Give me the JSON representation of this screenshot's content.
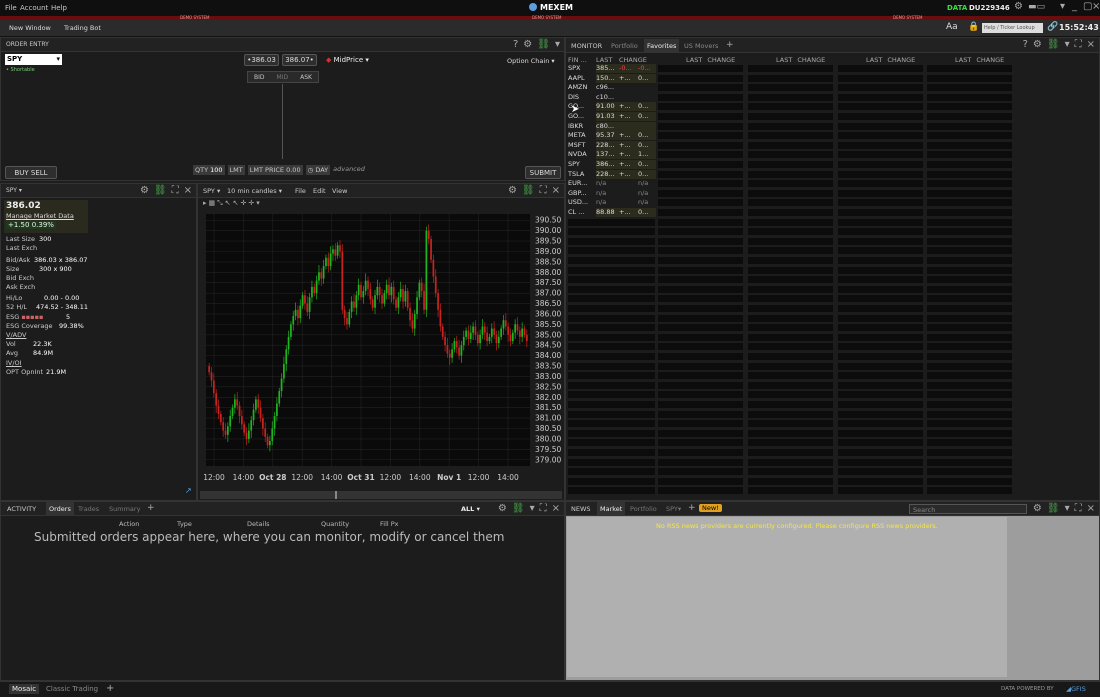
{
  "menu": {
    "file": "File",
    "account": "Account",
    "help": "Help"
  },
  "brand": "MEXEM",
  "demo_label": "DEMO SYSTEM",
  "data_label": "DATA",
  "account_id": "DU229346",
  "clock": "15:52:43",
  "toolbar": {
    "new_window": "New Window",
    "trading_bot": "Trading Bot",
    "font_size": "Aa",
    "ticker_lookup": "Help / Ticker Lookup"
  },
  "order_entry": {
    "title": "ORDER ENTRY",
    "symbol": "SPY",
    "shortable": "• Shortable",
    "bid_price": "•386.03",
    "ask_price": "386.07•",
    "bid": "BID",
    "mid": "MID",
    "ask": "ASK",
    "midprice": "MidPrice",
    "option_chain": "Option Chain",
    "buy_sell": "BUY SELL",
    "qty": "QTY",
    "qty_val": "100",
    "type": "LMT",
    "lmt_price": "LMT PRICE",
    "lmt_val": "0.00",
    "tif": "DAY",
    "advanced": "advanced",
    "submit": "SUBMIT"
  },
  "quote": {
    "symbol": "SPY",
    "last": "386.02",
    "manage": "Manage Market Data",
    "change": "+1.50",
    "pct": "0.39%",
    "rows": [
      [
        "Last Size",
        "300"
      ],
      [
        "Last Exch",
        ""
      ],
      [
        "Bid/Ask",
        "386.03 x 386.07"
      ],
      [
        "Size",
        "300 x 900"
      ],
      [
        "Bid Exch",
        ""
      ],
      [
        "Ask Exch",
        ""
      ],
      [
        "Hi/Lo",
        "0.00 - 0.00"
      ],
      [
        "52 H/L",
        "474.52 - 348.11"
      ],
      [
        "ESG",
        "5"
      ],
      [
        "ESG Coverage",
        "99.38%"
      ],
      [
        "V/ADV",
        ""
      ],
      [
        "Vol",
        "22.3K"
      ],
      [
        "Avg",
        "84.9M"
      ],
      [
        "IV/OI",
        ""
      ],
      [
        "OPT OpnInt",
        "21.9M"
      ]
    ]
  },
  "chart": {
    "symbol": "SPY",
    "interval": "10 min candles",
    "file": "File",
    "edit": "Edit",
    "view": "View"
  },
  "chart_data": {
    "type": "candlestick",
    "x_ticks": [
      "12:00",
      "14:00",
      "Oct 28",
      "12:00",
      "14:00",
      "Oct 31",
      "12:00",
      "14:00",
      "Nov 1",
      "12:00",
      "14:00"
    ],
    "y_ticks": [
      "390.50",
      "390.00",
      "389.50",
      "389.00",
      "388.50",
      "388.00",
      "387.50",
      "387.00",
      "386.50",
      "386.00",
      "385.50",
      "385.00",
      "384.50",
      "384.00",
      "383.50",
      "383.00",
      "382.50",
      "382.00",
      "381.50",
      "381.00",
      "380.50",
      "380.00",
      "379.50",
      "379.00"
    ],
    "ylim": [
      378.7,
      390.8
    ],
    "closes": [
      383.2,
      382.8,
      382.2,
      381.6,
      381.2,
      380.8,
      380.4,
      380.2,
      380.6,
      381.1,
      381.5,
      381.9,
      381.6,
      381.1,
      380.7,
      380.3,
      380.0,
      380.4,
      380.9,
      381.4,
      381.9,
      381.5,
      381.0,
      380.5,
      380.1,
      379.7,
      379.9,
      380.5,
      381.1,
      381.7,
      382.3,
      382.9,
      383.6,
      384.3,
      384.9,
      385.5,
      385.9,
      386.2,
      385.8,
      386.4,
      386.9,
      386.5,
      386.1,
      386.8,
      387.3,
      387.0,
      387.6,
      388.0,
      387.7,
      388.3,
      388.7,
      388.3,
      388.9,
      389.1,
      388.8,
      389.3,
      389.0,
      386.2,
      385.8,
      385.5,
      386.1,
      386.6,
      386.3,
      386.9,
      387.4,
      386.8,
      387.1,
      387.6,
      387.2,
      386.7,
      386.3,
      386.9,
      387.3,
      386.9,
      386.5,
      387.0,
      387.4,
      386.9,
      387.3,
      386.7,
      386.3,
      386.8,
      387.2,
      386.6,
      387.1,
      386.3,
      385.7,
      385.3,
      386.0,
      386.8,
      387.5,
      387.1,
      386.2,
      390.0,
      389.6,
      388.6,
      387.8,
      387.0,
      386.2,
      385.4,
      384.9,
      384.5,
      384.1,
      383.9,
      384.3,
      384.7,
      384.4,
      384.0,
      384.5,
      384.9,
      385.2,
      384.8,
      385.1,
      385.4,
      385.0,
      384.6,
      385.0,
      385.4,
      385.1,
      384.7,
      384.9,
      385.3,
      385.0,
      384.6,
      384.9,
      385.3,
      385.7,
      385.4,
      385.0,
      384.7,
      385.1,
      385.5,
      385.2,
      384.9,
      385.3,
      385.0,
      384.7
    ],
    "up_color": "#1fb51f",
    "down_color": "#c8231e"
  },
  "monitor": {
    "tabs": [
      "MONITOR",
      "Portfolio",
      "Favorites",
      "US Movers"
    ],
    "headers": [
      "FIN ...",
      "LAST",
      "CHANGE"
    ],
    "rows": [
      [
        "SPX",
        "385...",
        "-0...",
        "-0..."
      ],
      [
        "AAPL",
        "150...",
        "+...",
        "0..."
      ],
      [
        "AMZN",
        "c96...",
        "",
        ""
      ],
      [
        "DIS",
        "c10...",
        "",
        ""
      ],
      [
        "GO...",
        "91.00",
        "+...",
        "0..."
      ],
      [
        "GO...",
        "91.03",
        "+...",
        "0..."
      ],
      [
        "IBKR",
        "c80...",
        "",
        ""
      ],
      [
        "META",
        "95.37",
        "+...",
        "0..."
      ],
      [
        "MSFT",
        "228...",
        "+...",
        "0..."
      ],
      [
        "NVDA",
        "137...",
        "+...",
        "1..."
      ],
      [
        "SPY",
        "386...",
        "+...",
        "0..."
      ],
      [
        "TSLA",
        "228...",
        "+...",
        "0..."
      ],
      [
        "EUR...",
        "n/a",
        "",
        "n/a"
      ],
      [
        "GBP...",
        "n/a",
        "",
        "n/a"
      ],
      [
        "USD...",
        "n/a",
        "",
        "n/a"
      ],
      [
        "CL ...",
        "88.88",
        "+...",
        "0..."
      ]
    ],
    "empty_header": [
      "LAST",
      "CHANGE"
    ]
  },
  "activity": {
    "tabs": [
      "ACTIVITY",
      "Orders",
      "Trades",
      "Summary"
    ],
    "all": "ALL",
    "cols": [
      "Action",
      "Type",
      "Details",
      "Quantity",
      "Fill Px"
    ],
    "empty": "Submitted orders appear here, where you can monitor, modify or cancel them"
  },
  "news": {
    "tabs": [
      "NEWS",
      "Market",
      "Portfolio",
      "SPY"
    ],
    "new": "New!",
    "search": "Search",
    "msg": "No RSS news providers are currently configured. Please configure RSS news providers."
  },
  "bottom": {
    "mosaic": "Mosaic",
    "classic": "Classic Trading",
    "data_by": "DATA POWERED BY",
    "gfis": "GFIS"
  }
}
